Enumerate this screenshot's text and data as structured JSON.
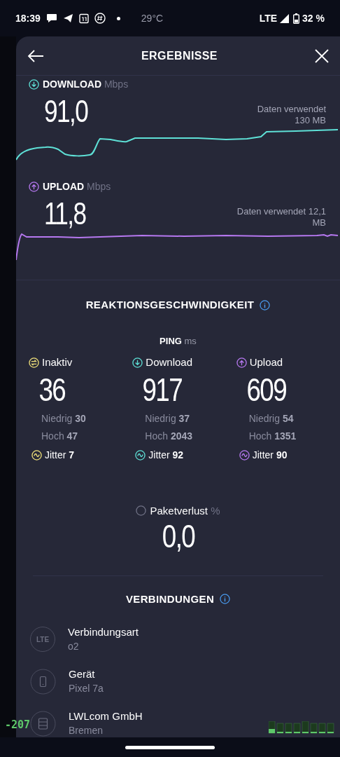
{
  "status_bar": {
    "time": "18:39",
    "temperature": "29°C",
    "network": "LTE",
    "battery": "32 %"
  },
  "header": {
    "title": "ERGEBNISSE"
  },
  "speeds": [
    {
      "kind": "download",
      "label": "DOWNLOAD",
      "unit": "Mbps",
      "value": "91,0",
      "data_used": [
        "Daten verwendet",
        "130 MB"
      ],
      "color": "#5ee0d6"
    },
    {
      "kind": "upload",
      "label": "UPLOAD",
      "unit": "Mbps",
      "value": "11,8",
      "data_used": [
        "Daten verwendet 12,1",
        "MB"
      ],
      "color": "#b678f0"
    }
  ],
  "latency": {
    "title": "REAKTIONSGESCHWINDIGKEIT",
    "ping_label": "PING",
    "ping_unit": "ms",
    "columns": [
      {
        "kind": "idle",
        "label": "Inaktiv",
        "value": "36",
        "low_label": "Niedrig",
        "low": "30",
        "high_label": "Hoch",
        "high": "47",
        "jitter_label": "Jitter",
        "jitter": "7",
        "color": "#f0e07a"
      },
      {
        "kind": "download",
        "label": "Download",
        "value": "917",
        "low_label": "Niedrig",
        "low": "37",
        "high_label": "Hoch",
        "high": "2043",
        "jitter_label": "Jitter",
        "jitter": "92",
        "color": "#5ee0d6"
      },
      {
        "kind": "upload",
        "label": "Upload",
        "value": "609",
        "low_label": "Niedrig",
        "low": "54",
        "high_label": "Hoch",
        "high": "1351",
        "jitter_label": "Jitter",
        "jitter": "90",
        "color": "#b678f0"
      }
    ],
    "packet_loss": {
      "label": "Paketverlust",
      "unit": "%",
      "value": "0,0"
    }
  },
  "connections": {
    "title": "VERBINDUNGEN",
    "items": [
      {
        "kind": "lte",
        "icon_text": "LTE",
        "title": "Verbindungsart",
        "subtitle": "o2"
      },
      {
        "kind": "device",
        "title": "Gerät",
        "subtitle": "Pixel 7a"
      },
      {
        "kind": "server",
        "title": "LWLcom GmbH",
        "subtitle": "Bremen"
      }
    ]
  },
  "debug_overlay": {
    "value": "-207"
  }
}
